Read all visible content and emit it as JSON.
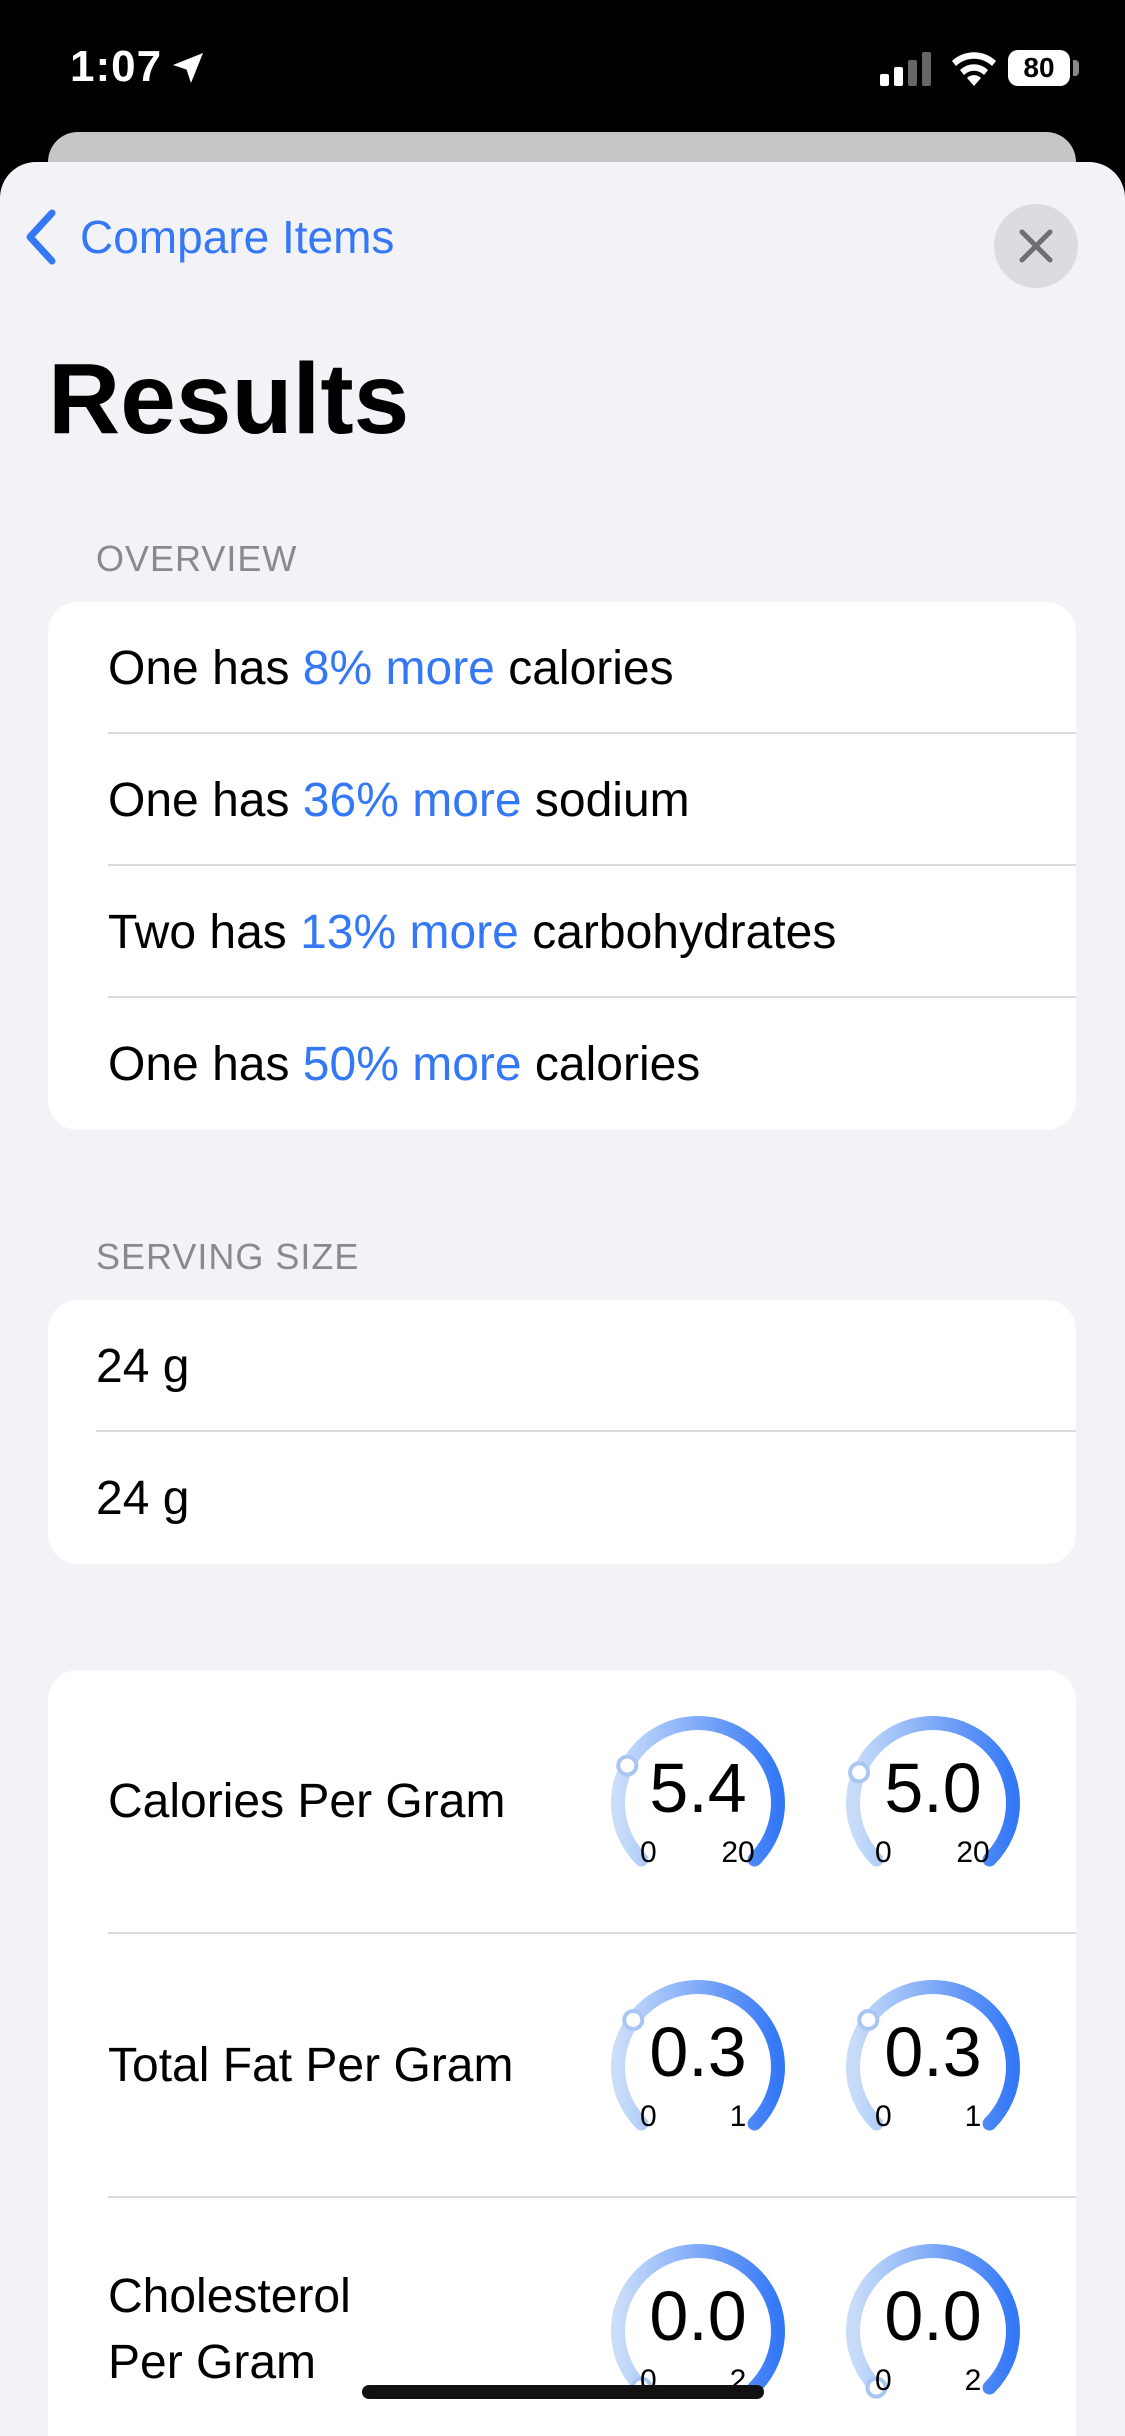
{
  "status_bar": {
    "time": "1:07",
    "battery": "80"
  },
  "nav": {
    "back_label": "Compare Items"
  },
  "page_title": "Results",
  "overview": {
    "header": "OVERVIEW",
    "rows": [
      {
        "prefix": "One has ",
        "highlight": "8% more",
        "suffix": " calories"
      },
      {
        "prefix": "One has ",
        "highlight": "36% more",
        "suffix": " sodium"
      },
      {
        "prefix": "Two has ",
        "highlight": "13% more",
        "suffix": " carbohydrates"
      },
      {
        "prefix": "One has ",
        "highlight": "50% more",
        "suffix": " calories"
      }
    ]
  },
  "serving_size": {
    "header": "SERVING SIZE",
    "rows": [
      "24 g",
      "24 g"
    ]
  },
  "metrics": [
    {
      "label": "Calories Per Gram",
      "gauges": [
        {
          "value": "5.4",
          "min": "0",
          "max": "20",
          "fraction": 0.27
        },
        {
          "value": "5.0",
          "min": "0",
          "max": "20",
          "fraction": 0.25
        }
      ]
    },
    {
      "label": "Total Fat Per Gram",
      "gauges": [
        {
          "value": "0.3",
          "min": "0",
          "max": "1",
          "fraction": 0.3
        },
        {
          "value": "0.3",
          "min": "0",
          "max": "1",
          "fraction": 0.3
        }
      ]
    },
    {
      "label": "Cholesterol Per Gram",
      "gauges": [
        {
          "value": "0.0",
          "min": "0",
          "max": "2",
          "fraction": 0.0
        },
        {
          "value": "0.0",
          "min": "0",
          "max": "2",
          "fraction": 0.0
        }
      ]
    }
  ],
  "colors": {
    "accent": "#3478f6",
    "gauge_light": "#c9ddf9",
    "gauge_dark": "#3478f6"
  }
}
